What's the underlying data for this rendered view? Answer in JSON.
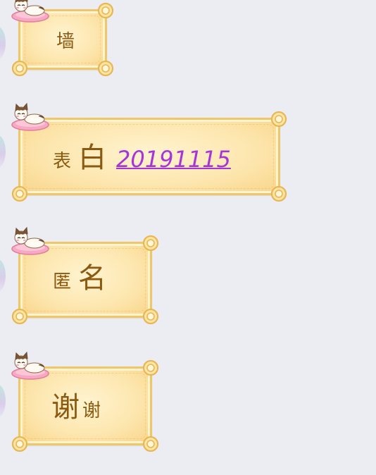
{
  "messages": [
    {
      "id": "m1",
      "parts": [
        {
          "text": "墙",
          "size": "sm"
        }
      ]
    },
    {
      "id": "m2",
      "parts": [
        {
          "text": "表",
          "size": "sm"
        },
        {
          "text": "白",
          "size": "lg"
        }
      ],
      "link": "20191115"
    },
    {
      "id": "m3",
      "parts": [
        {
          "text": "匿",
          "size": "sm"
        },
        {
          "text": "名",
          "size": "lg"
        }
      ]
    },
    {
      "id": "m4",
      "parts": [
        {
          "text": "谢",
          "size": "lg"
        },
        {
          "text": "谢",
          "size": "sm"
        }
      ]
    }
  ],
  "colors": {
    "background": "#ebedf2",
    "bubble_fill": "#fde7b0",
    "bubble_border": "#efc76b",
    "text": "#8a5a12",
    "link": "#a634d6"
  },
  "icons": {
    "bubble_decoration": "cat-on-pillow-icon",
    "corner_decoration": "knot-icon"
  }
}
